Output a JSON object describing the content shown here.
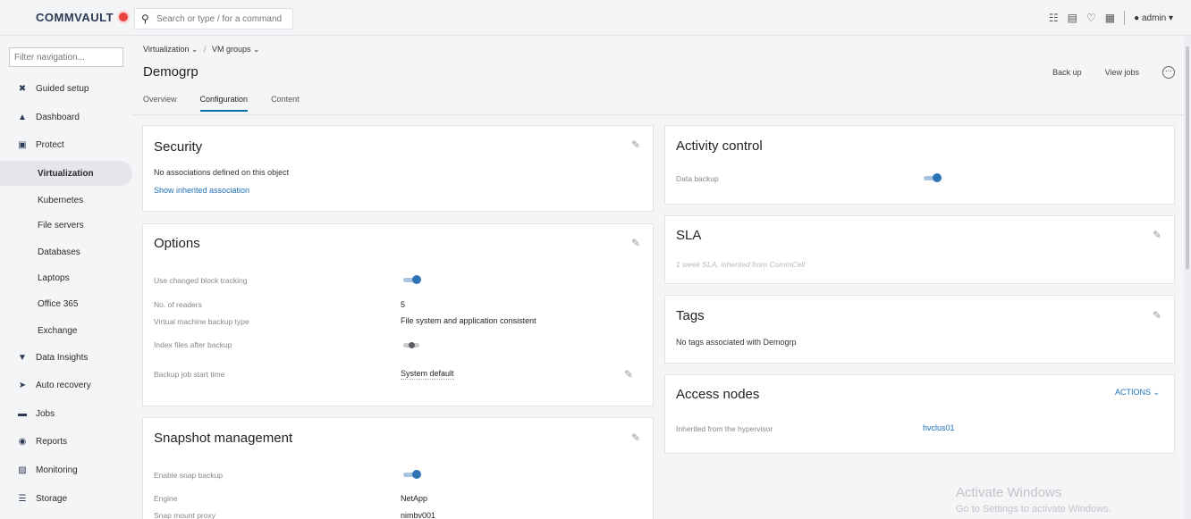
{
  "app": {
    "brand": "COMMVAULT",
    "search_placeholder": "Search or type / for a command",
    "user": "admin ▾"
  },
  "sidebar": {
    "filter_placeholder": "Filter navigation...",
    "items": [
      {
        "label": "Guided setup",
        "icon": "tools-icon"
      },
      {
        "label": "Dashboard",
        "icon": "dashboard-icon"
      },
      {
        "label": "Protect",
        "icon": "protect-icon"
      },
      {
        "label": "Virtualization"
      },
      {
        "label": "Kubernetes"
      },
      {
        "label": "File servers"
      },
      {
        "label": "Databases"
      },
      {
        "label": "Laptops"
      },
      {
        "label": "Office 365"
      },
      {
        "label": "Exchange"
      },
      {
        "label": "Data Insights",
        "icon": "shield-icon"
      },
      {
        "label": "Auto recovery",
        "icon": "recovery-icon"
      },
      {
        "label": "Jobs",
        "icon": "jobs-icon"
      },
      {
        "label": "Reports",
        "icon": "reports-icon"
      },
      {
        "label": "Monitoring",
        "icon": "monitoring-icon"
      },
      {
        "label": "Storage",
        "icon": "storage-icon"
      }
    ]
  },
  "header": {
    "breadcrumb_1": "Virtualization ⌄",
    "breadcrumb_sep": "/",
    "breadcrumb_2": "VM groups ⌄",
    "title": "Demogrp",
    "back_up": "Back up",
    "view_jobs": "View jobs",
    "tabs": [
      "Overview",
      "Configuration",
      "Content"
    ]
  },
  "security": {
    "title": "Security",
    "text": "No associations defined on this object",
    "link": "Show inherited association"
  },
  "options": {
    "title": "Options",
    "rows": [
      {
        "label": "Use changed block tracking",
        "toggle": true
      },
      {
        "label": "No. of readers",
        "value": "5"
      },
      {
        "label": "Virtual machine backup type",
        "value": "File system and application consistent"
      },
      {
        "label": "Index files after backup",
        "toggle": false
      },
      {
        "label": "Backup job start time",
        "value": "System default"
      }
    ]
  },
  "snapshot": {
    "title": "Snapshot management",
    "rows": [
      {
        "label": "Enable snap backup",
        "toggle": true
      },
      {
        "label": "Engine",
        "value": "NetApp"
      },
      {
        "label": "Snap mount proxy",
        "value": "nimbv001"
      }
    ]
  },
  "activity": {
    "title": "Activity control",
    "label": "Data backup",
    "toggle": true
  },
  "sla": {
    "title": "SLA",
    "text": "1 week SLA, inherited from CommCell"
  },
  "tags": {
    "title": "Tags",
    "text": "No tags associated with Demogrp"
  },
  "access_nodes": {
    "title": "Access nodes",
    "actions": "ACTIONS ⌄",
    "label": "Inherited from the hypervisor",
    "value": "hvclus01"
  },
  "watermark": {
    "line1": "Activate Windows",
    "line2": "Go to Settings to activate Windows."
  }
}
